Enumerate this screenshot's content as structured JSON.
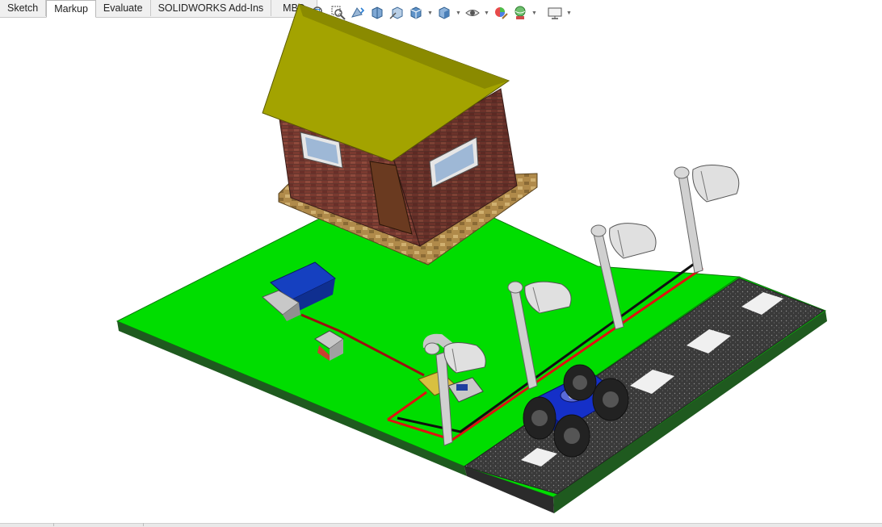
{
  "command_manager": {
    "tabs": [
      {
        "label": "Sketch",
        "active": false
      },
      {
        "label": "Markup",
        "active": true
      },
      {
        "label": "Evaluate",
        "active": false
      },
      {
        "label": "SOLIDWORKS Add-Ins",
        "active": false
      },
      {
        "label": "MBD",
        "active": false
      }
    ]
  },
  "heads_up_toolbar": {
    "icons": [
      "zoom-to-fit-icon",
      "zoom-to-area-icon",
      "previous-view-icon",
      "section-view-icon",
      "dynamic-annotation-icon",
      "view-orientation-icon",
      "display-style-icon",
      "hide-show-items-icon",
      "edit-appearance-icon",
      "apply-scene-icon",
      "view-settings-icon"
    ]
  },
  "colors": {
    "grass": "#00dd00",
    "road": "#3a3a3a",
    "roof": "#a3a300",
    "brick": "#7a3a30",
    "car_body": "#1530c8",
    "pole": "#d0d0d0",
    "wire_red": "#e01010"
  }
}
